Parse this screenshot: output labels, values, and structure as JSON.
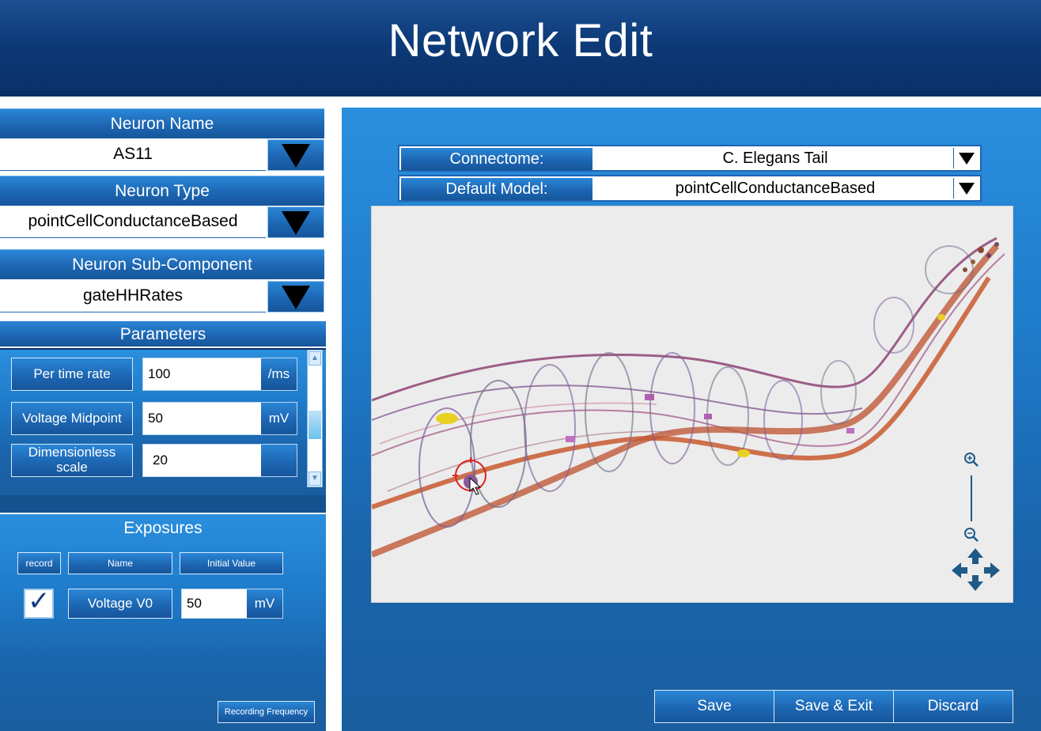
{
  "header": {
    "title": "Network Edit"
  },
  "neuron_name": {
    "label": "Neuron Name",
    "value": "AS11"
  },
  "neuron_type": {
    "label": "Neuron Type",
    "value": "pointCellConductanceBased"
  },
  "neuron_sub_component": {
    "label": "Neuron Sub-Component",
    "value": "gateHHRates"
  },
  "parameters": {
    "title": "Parameters",
    "rows": [
      {
        "label": "Per time rate",
        "value": "100",
        "unit": "/ms"
      },
      {
        "label": "Voltage Midpoint",
        "value": "50",
        "unit": "mV"
      },
      {
        "label": "Dimensionless scale",
        "value": "20",
        "unit": ""
      }
    ]
  },
  "exposures": {
    "title": "Exposures",
    "headers": {
      "record": "record",
      "name": "Name",
      "initial_value": "Initial Value"
    },
    "rows": [
      {
        "recorded": true,
        "name": "Voltage V0",
        "value": "50",
        "unit": "mV"
      }
    ],
    "recording_frequency_label": "Recording Frequency"
  },
  "connectome": {
    "label": "Connectome:",
    "value": "C. Elegans Tail"
  },
  "default_model": {
    "label": "Default Model:",
    "value": "pointCellConductanceBased"
  },
  "viewer": {
    "zoom_in_icon": "zoom-in-icon",
    "zoom_out_icon": "zoom-out-icon",
    "pan_icon": "pan-arrows-icon"
  },
  "actions": {
    "save": "Save",
    "save_exit": "Save & Exit",
    "discard": "Discard"
  },
  "colors": {
    "header_dark": "#0d3a78",
    "button_blue": "#1c64b0",
    "panel_blue": "#1f7ccb",
    "nav_icon": "#1f5a86"
  }
}
